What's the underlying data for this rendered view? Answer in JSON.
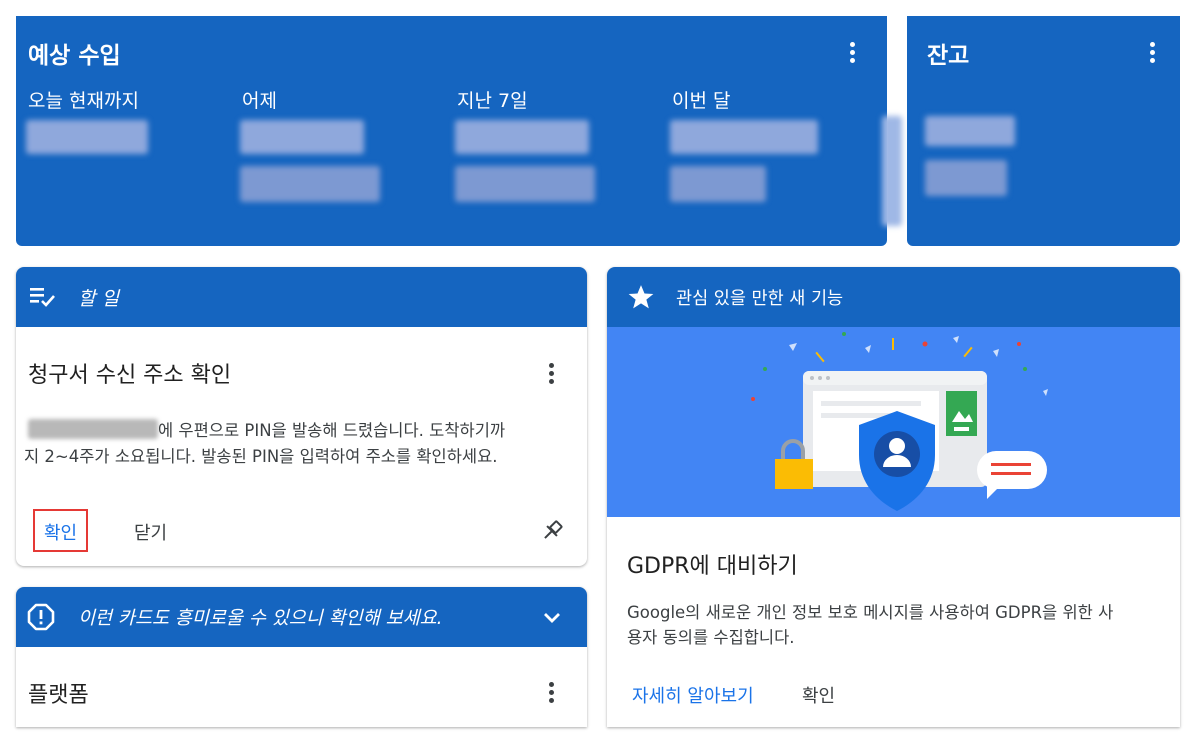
{
  "estimated_earnings": {
    "title": "예상 수입",
    "columns": [
      {
        "label": "오늘 현재까지"
      },
      {
        "label": "어제"
      },
      {
        "label": "지난 7일"
      },
      {
        "label": "이번 달"
      }
    ]
  },
  "balance": {
    "title": "잔고"
  },
  "todo": {
    "header": "할 일",
    "card_title": "청구서 수신 주소 확인",
    "body_line1": "에 우편으로 PIN을 발송해 드렸습니다. 도착하기까",
    "body_line2": "지 2~4주가 소요됩니다. 발송된 PIN을 입력하여 주소를 확인하세요.",
    "confirm_label": "확인",
    "close_label": "닫기"
  },
  "suggestion": {
    "text": "이런 카드도 흥미로울 수 있으니 확인해 보세요."
  },
  "platform": {
    "title": "플랫폼"
  },
  "new_features": {
    "header": "관심 있을 만한 새 기능",
    "title": "GDPR에 대비하기",
    "body_line1": "Google의 새로운 개인 정보 보호 메시지를 사용하여 GDPR을 위한 사",
    "body_line2": "용자 동의를 수집합니다.",
    "learn_more_label": "자세히 알아보기",
    "confirm_label": "확인"
  },
  "colors": {
    "primary_blue": "#1565c0",
    "illustration_blue": "#4285f4",
    "highlight_red": "#e53935"
  }
}
